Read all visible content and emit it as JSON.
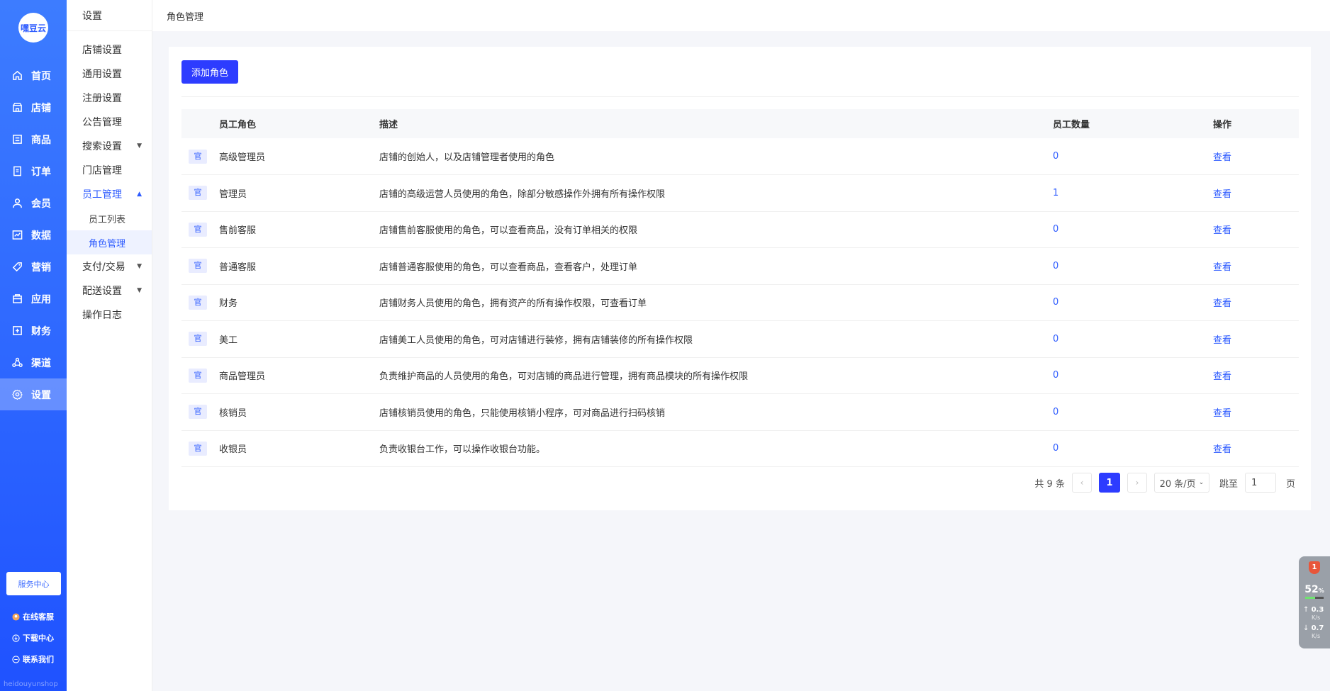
{
  "brand": {
    "logo_text": "嘿豆云",
    "footer": "heidouyunshop"
  },
  "nav": [
    {
      "label": "首页",
      "icon": "home-icon"
    },
    {
      "label": "店铺",
      "icon": "store-icon"
    },
    {
      "label": "商品",
      "icon": "goods-icon"
    },
    {
      "label": "订单",
      "icon": "order-icon"
    },
    {
      "label": "会员",
      "icon": "member-icon"
    },
    {
      "label": "数据",
      "icon": "chart-icon"
    },
    {
      "label": "营销",
      "icon": "tag-icon"
    },
    {
      "label": "应用",
      "icon": "app-icon"
    },
    {
      "label": "财务",
      "icon": "finance-icon"
    },
    {
      "label": "渠道",
      "icon": "channel-icon"
    },
    {
      "label": "设置",
      "icon": "gear-icon"
    }
  ],
  "service_center": "服务中心",
  "side_links": [
    "在线客服",
    "下载中心",
    "联系我们"
  ],
  "sub": {
    "title": "设置",
    "items": [
      "店铺设置",
      "通用设置",
      "注册设置",
      "公告管理",
      "搜索设置",
      "门店管理",
      "员工管理",
      "支付/交易",
      "配送设置",
      "操作日志"
    ],
    "children": [
      "员工列表",
      "角色管理"
    ]
  },
  "header": {
    "title": "角色管理"
  },
  "main": {
    "add_button": "添加角色",
    "columns": [
      "员工角色",
      "描述",
      "员工数量",
      "操作"
    ],
    "tag_text": "官",
    "rows": [
      {
        "role": "高级管理员",
        "desc": "店铺的创始人，以及店铺管理者使用的角色",
        "count": "0",
        "action": "查看"
      },
      {
        "role": "管理员",
        "desc": "店铺的高级运营人员使用的角色，除部分敏感操作外拥有所有操作权限",
        "count": "1",
        "action": "查看"
      },
      {
        "role": "售前客服",
        "desc": "店铺售前客服使用的角色，可以查看商品，没有订单相关的权限",
        "count": "0",
        "action": "查看"
      },
      {
        "role": "普通客服",
        "desc": "店铺普通客服使用的角色，可以查看商品，查看客户，处理订单",
        "count": "0",
        "action": "查看"
      },
      {
        "role": "财务",
        "desc": "店铺财务人员使用的角色，拥有资产的所有操作权限，可查看订单",
        "count": "0",
        "action": "查看"
      },
      {
        "role": "美工",
        "desc": "店铺美工人员使用的角色，可对店铺进行装修，拥有店铺装修的所有操作权限",
        "count": "0",
        "action": "查看"
      },
      {
        "role": "商品管理员",
        "desc": "负责维护商品的人员使用的角色，可对店铺的商品进行管理，拥有商品模块的所有操作权限",
        "count": "0",
        "action": "查看"
      },
      {
        "role": "核销员",
        "desc": "店铺核销员使用的角色，只能使用核销小程序，可对商品进行扫码核销",
        "count": "0",
        "action": "查看"
      },
      {
        "role": "收银员",
        "desc": "负责收银台工作，可以操作收银台功能。",
        "count": "0",
        "action": "查看"
      }
    ],
    "pagination": {
      "total": "共 9 条",
      "current": "1",
      "page_size": "20 条/页",
      "jump_label": "跳至",
      "jump_value": "1",
      "page_suffix": "页"
    }
  },
  "widget": {
    "badge": "1",
    "percent": "52",
    "percent_unit": "%",
    "up": "0.3",
    "down": "0.7",
    "unit": "K/s"
  }
}
